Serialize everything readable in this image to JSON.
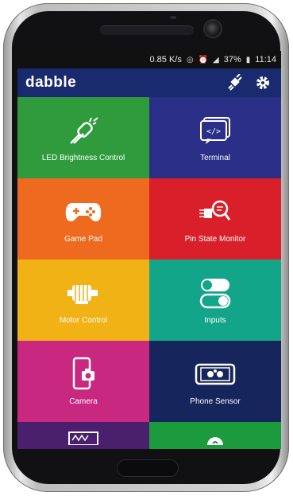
{
  "status_bar": {
    "speed": "0.85 K/s",
    "icons": [
      "hotspot-icon",
      "alarm-icon",
      "signal-icon"
    ],
    "battery": "37%",
    "time": "11:14"
  },
  "app": {
    "logo": "dabble",
    "actions": [
      "bluetooth-connect-icon",
      "settings-gear-icon"
    ]
  },
  "tiles": [
    {
      "label": "LED Brightness Control",
      "color": "#2f9b3c",
      "icon": "led-icon"
    },
    {
      "label": "Terminal",
      "color": "#2b2f87",
      "icon": "terminal-icon"
    },
    {
      "label": "Game Pad",
      "color": "#ee6a1e",
      "icon": "gamepad-icon"
    },
    {
      "label": "Pin State Monitor",
      "color": "#d9202a",
      "icon": "pin-monitor-icon"
    },
    {
      "label": "Motor Control",
      "color": "#f0b214",
      "icon": "motor-icon"
    },
    {
      "label": "Inputs",
      "color": "#13a58a",
      "icon": "toggle-switch-icon"
    },
    {
      "label": "Camera",
      "color": "#c8287f",
      "icon": "camera-phone-icon"
    },
    {
      "label": "Phone Sensor",
      "color": "#16255c",
      "icon": "phone-sensor-icon"
    }
  ],
  "partial_tiles": [
    {
      "color": "#4a1f6e",
      "icon": "oscilloscope-icon"
    },
    {
      "color": "#1c9a3e",
      "icon": "speaker-icon"
    }
  ]
}
